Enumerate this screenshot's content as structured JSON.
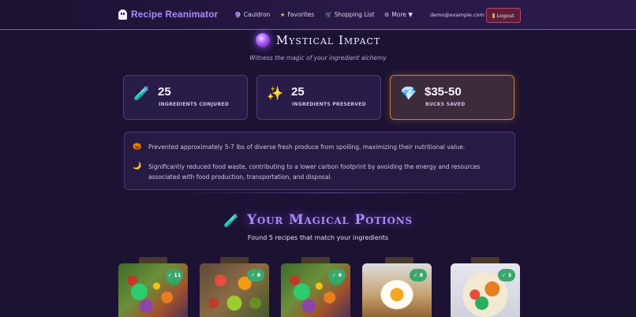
{
  "nav": {
    "brand": "Recipe Reanimator",
    "links": [
      {
        "icon": "🔮",
        "icon_name": "cauldron-icon",
        "label": "Cauldron"
      },
      {
        "icon": "★",
        "icon_name": "star-icon",
        "label": "Favorites"
      },
      {
        "icon": "🛒",
        "icon_name": "cart-icon",
        "label": "Shopping List"
      },
      {
        "icon": "⚙",
        "icon_name": "gear-icon",
        "label": "More ▼"
      }
    ],
    "email": "demo@example.com",
    "logout": "Logout"
  },
  "impact": {
    "title": "Mystical Impact",
    "subtitle": "Witness the magic of your ingredient alchemy",
    "stats": [
      {
        "icon": "🧪",
        "icon_name": "test-tube-icon",
        "value": "25",
        "label": "INGREDIENTS CONJURED"
      },
      {
        "icon": "✨",
        "icon_name": "sparkles-icon",
        "value": "25",
        "label": "INGREDIENTS PRESERVED"
      },
      {
        "icon": "💎",
        "icon_name": "gem-icon",
        "value": "$35-50",
        "label": "BUCKS SAVED"
      }
    ],
    "notes": [
      {
        "icon": "🎃",
        "icon_name": "pumpkin-icon",
        "text": "Prevented approximately 5-7 lbs of diverse fresh produce from spoiling, maximizing their nutritional value."
      },
      {
        "icon": "🌙",
        "icon_name": "moon-icon",
        "text": "Significantly reduced food waste, contributing to a lower carbon footprint by avoiding the energy and resources associated with food production, transportation, and disposal."
      }
    ]
  },
  "potions": {
    "icon": "🧪",
    "title": "Your Magical Potions",
    "subtitle": "Found 5 recipes that match your ingredients",
    "cards": [
      {
        "badge": "✓ 11",
        "image": "salad"
      },
      {
        "badge": "✓ 8",
        "image": "bowl"
      },
      {
        "badge": "✓ 9",
        "image": "salad"
      },
      {
        "badge": "✓ 8",
        "image": "egg-toast"
      },
      {
        "badge": "✓ 3",
        "image": "plate"
      }
    ]
  }
}
